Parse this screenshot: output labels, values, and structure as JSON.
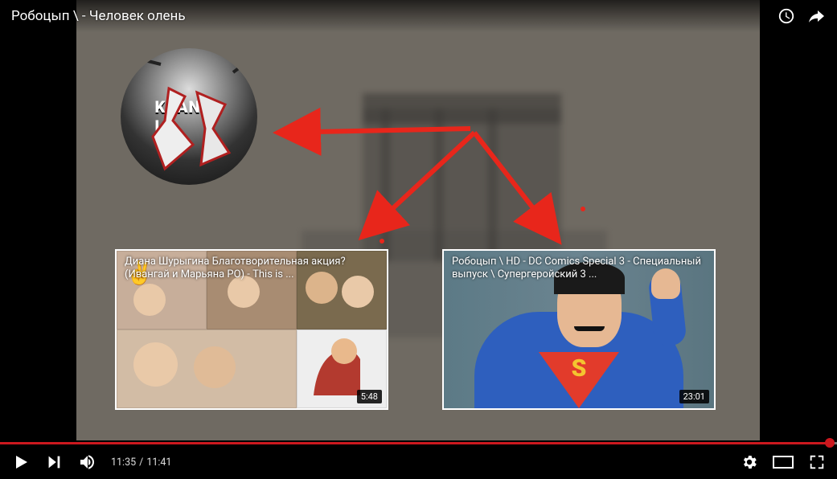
{
  "title": "Робоцып \\ - Человек олень",
  "time": {
    "current": "11:35",
    "duration": "11:41"
  },
  "progress": {
    "percent": 99.1,
    "buffer_percent": 100
  },
  "avatar_text": "KSANDR\nLK",
  "endcards": [
    {
      "title": "Диана Шурыгина Благотворительная акция?(Ивангай и Марьяна РО) - This is ...",
      "duration": "5:48"
    },
    {
      "title": "Робоцып \\ HD - DC Comics Special 3 - Специальный выпуск \\ Супергеройский 3 ...",
      "duration": "23:01"
    }
  ],
  "icons": {
    "watchLater": "watch-later-icon",
    "share": "share-icon",
    "play": "play-icon",
    "next": "next-icon",
    "volume": "volume-icon",
    "settings": "settings-icon",
    "theater": "theater-icon",
    "fullscreen": "fullscreen-icon"
  }
}
